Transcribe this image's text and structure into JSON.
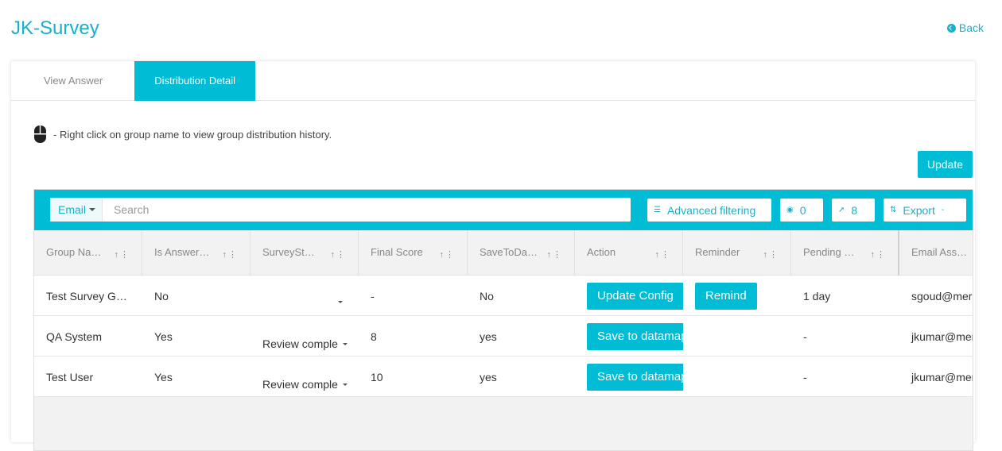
{
  "app": {
    "title": "JK-Survey",
    "back_label": "Back"
  },
  "tabs": [
    {
      "label": "View Answer",
      "active": false
    },
    {
      "label": "Distribution Detail",
      "active": true
    }
  ],
  "hint": {
    "text": "- Right click on group name to view group distribution history."
  },
  "update_label": "Update",
  "toolbar": {
    "email_filter": "Email",
    "search_placeholder": "Search",
    "advanced_filtering": "Advanced filtering",
    "visible_count": "0",
    "pinned_count": "8",
    "export_label": "Export"
  },
  "columns": [
    "Group Na…",
    "Is Answer…",
    "SurveySt…",
    "Final Score",
    "SaveToDa…",
    "Action",
    "Reminder",
    "Pending …",
    "Email Ass…"
  ],
  "rows": [
    {
      "group": "Test Survey G…",
      "answered": "No",
      "status": "",
      "score": "-",
      "save": "No",
      "action": "Update Config",
      "reminder": "Remind",
      "pending": "1 day",
      "email": "sgoud@meru"
    },
    {
      "group": "QA System",
      "answered": "Yes",
      "status": "Review comple",
      "score": "8",
      "save": "yes",
      "action": "Save to datamap",
      "reminder": "",
      "pending": "-",
      "email": "jkumar@meru"
    },
    {
      "group": "Test User",
      "answered": "Yes",
      "status": "Review comple",
      "score": "10",
      "save": "yes",
      "action": "Save to datamap",
      "reminder": "",
      "pending": "-",
      "email": "jkumar@meru"
    }
  ],
  "colors": {
    "accent": "#00bcd4",
    "title": "#1ab0c9"
  }
}
